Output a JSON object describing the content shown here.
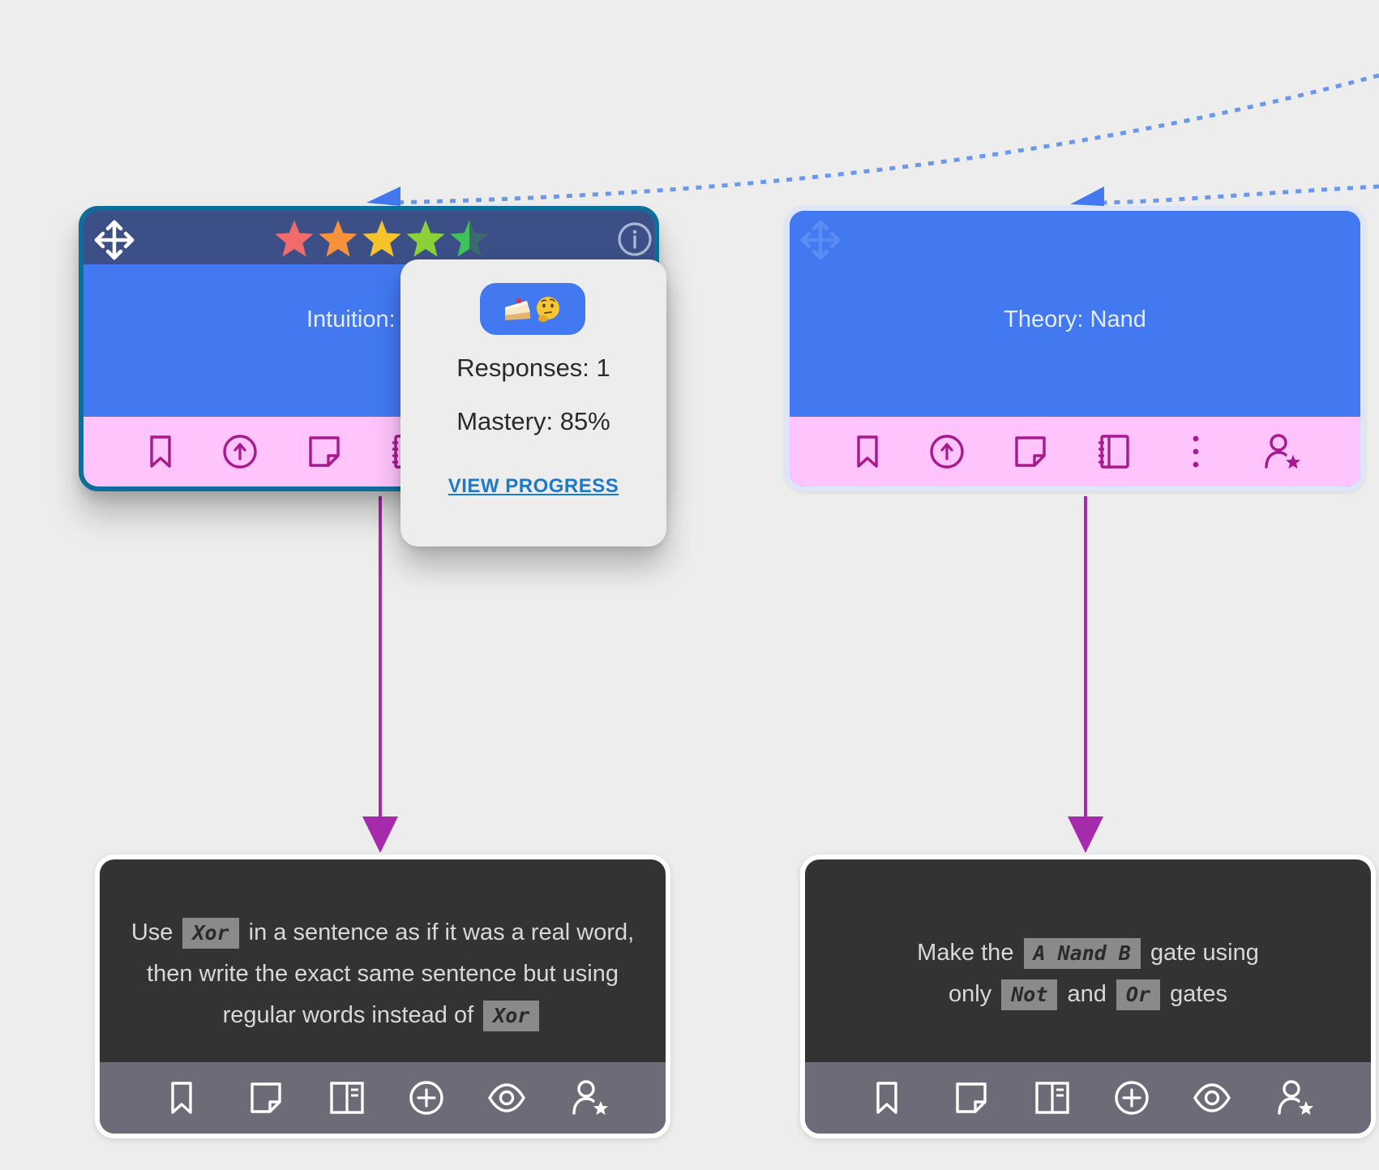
{
  "colors": {
    "background": "#ededed",
    "concept_blue": "#4279f1",
    "selected_header": "#3c4f87",
    "selected_border": "#0f6e99",
    "pink_toolbar": "#ffc4fc",
    "toolbar_icon": "#a8188f",
    "arrow_purple": "#a52aac",
    "dotted_arrow": "#6a98ec",
    "question_bg": "#333333",
    "question_toolbar": "#6b6c78",
    "link": "#1f78c8"
  },
  "concept_cards": [
    {
      "title": "Intuition:",
      "selected": true,
      "rating": 4.5,
      "toolbar_icons": [
        "bookmark-icon",
        "arrow-up-circle-icon",
        "sticky-note-icon",
        "notebook-icon"
      ]
    },
    {
      "title": "Theory: Nand",
      "selected": false,
      "toolbar_icons": [
        "bookmark-icon",
        "arrow-up-circle-icon",
        "sticky-note-icon",
        "notebook-icon",
        "more-vertical-icon",
        "user-star-icon"
      ]
    }
  ],
  "popover": {
    "emojis": "cake-thinking-face-emoji",
    "responses": "Responses: 1",
    "mastery": "Mastery: 85%",
    "link": "VIEW PROGRESS"
  },
  "question_cards": [
    {
      "parts": {
        "t1": "Use",
        "c1": "Xor",
        "t2": "in a sentence as if it was a real word,",
        "t3": "then write the exact same sentence but using",
        "t4": "regular words instead of",
        "c2": "Xor"
      },
      "toolbar_icons": [
        "bookmark-icon",
        "sticky-note-icon",
        "split-view-icon",
        "plus-circle-icon",
        "eye-icon",
        "user-star-icon"
      ]
    },
    {
      "parts": {
        "t1": "Make the",
        "c1": "A Nand B",
        "t2": "gate using",
        "t3": "only",
        "c2": "Not",
        "t4": "and",
        "c3": "Or",
        "t5": "gates"
      },
      "toolbar_icons": [
        "bookmark-icon",
        "sticky-note-icon",
        "split-view-icon",
        "plus-circle-icon",
        "eye-icon",
        "user-star-icon"
      ]
    }
  ]
}
